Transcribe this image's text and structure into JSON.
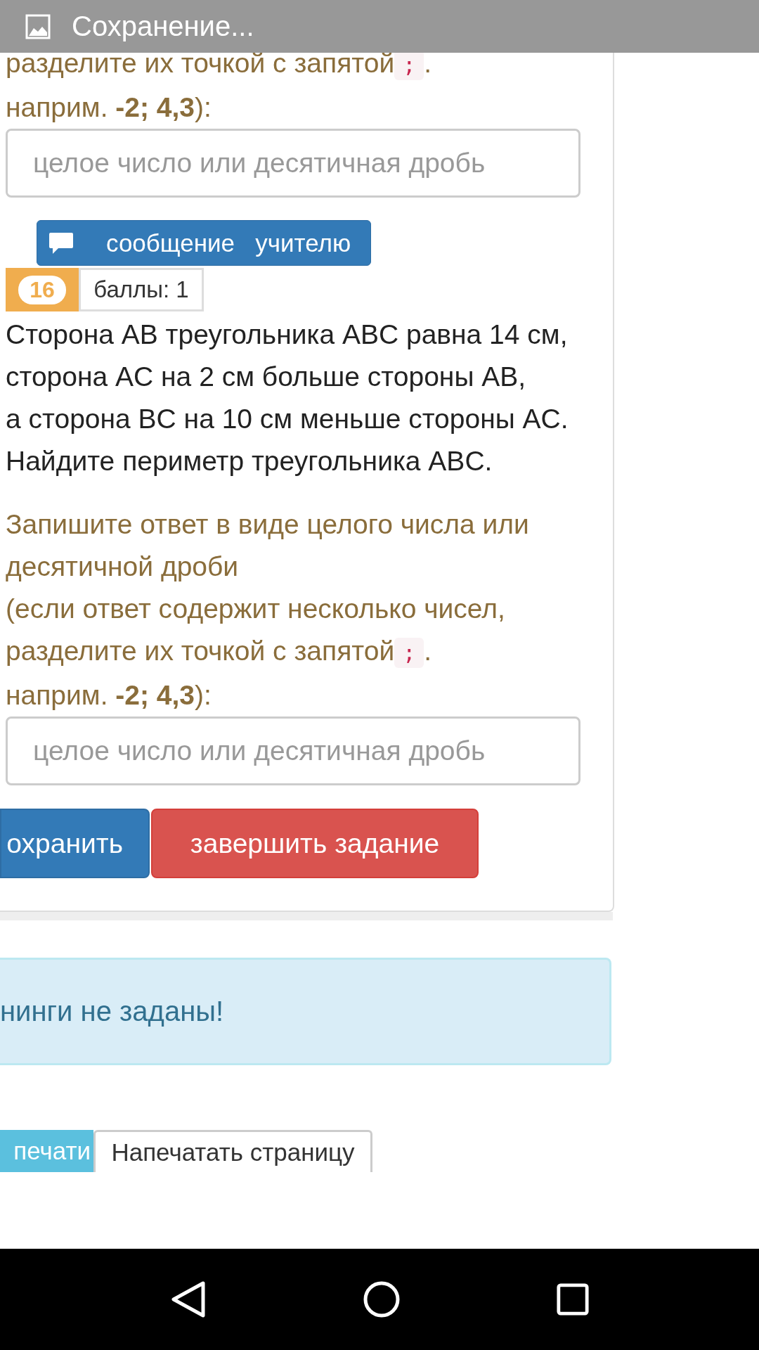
{
  "notification": {
    "title": "Сохранение..."
  },
  "previous_task": {
    "instruction_line": "разделите их точкой с запятой",
    "code": ";",
    "after_code": ".",
    "example": "наприм. **-2; 4,3**):",
    "answer": {
      "placeholder": "целое число или десятичная дробь"
    }
  },
  "message_button": "сообщение   учителю",
  "task": {
    "number": "16",
    "points": "баллы: 1",
    "problem": [
      "Сторона AB треугольника ABC равна 14 см, сторона AC на 2 см больше стороны AB,",
      "а сторона BC на 10 см меньше стороны AC.",
      "Найдите периметр треугольника ABC."
    ],
    "instruction": "Запишите ответ в виде целого числа или десятичной дроби",
    "instruction_note": "(если ответ содержит несколько чисел,",
    "instruction_note_2": "разделите их точкой с запятой",
    "code": ";",
    "after_code": ".",
    "example": "наприм. **-2; 4,3**):",
    "answer": {
      "placeholder": "целое число или десятичная дробь"
    }
  },
  "buttons": [
    {
      "label": "охранить",
      "kind": "primary"
    },
    {
      "label": "завершить задание",
      "kind": "danger"
    }
  ],
  "alert": "нинги не заданы!",
  "print_buttons": [
    {
      "label": "печати",
      "kind": "info"
    },
    {
      "label": "Напечатать страницу",
      "kind": "default"
    }
  ]
}
